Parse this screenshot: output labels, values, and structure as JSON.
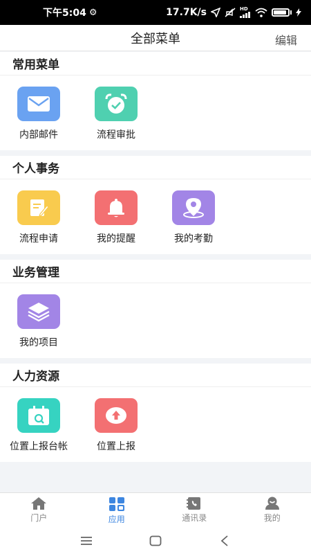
{
  "status_bar": {
    "time": "下午5:04",
    "speed": "17.7K/s",
    "network_badge": "HD"
  },
  "header": {
    "title": "全部菜单",
    "edit_label": "编辑"
  },
  "sections": [
    {
      "title": "常用菜单",
      "items": [
        {
          "label": "内部邮件",
          "icon": "mail-icon",
          "color": "#6aa2f1"
        },
        {
          "label": "流程审批",
          "icon": "alarm-clock-icon",
          "color": "#4fd0b0"
        }
      ]
    },
    {
      "title": "个人事务",
      "items": [
        {
          "label": "流程申请",
          "icon": "edit-note-icon",
          "color": "#f9cb4e"
        },
        {
          "label": "我的提醒",
          "icon": "bell-icon",
          "color": "#f37072"
        },
        {
          "label": "我的考勤",
          "icon": "location-icon",
          "color": "#a285e6"
        }
      ]
    },
    {
      "title": "业务管理",
      "items": [
        {
          "label": "我的项目",
          "icon": "layers-icon",
          "color": "#a285e6"
        }
      ]
    },
    {
      "title": "人力资源",
      "items": [
        {
          "label": "位置上报台帐",
          "icon": "calendar-search-icon",
          "color": "#36d3c1"
        },
        {
          "label": "位置上报",
          "icon": "upload-icon",
          "color": "#f37072"
        }
      ]
    }
  ],
  "bottom_nav": [
    {
      "label": "门户",
      "icon": "home-icon",
      "active": false
    },
    {
      "label": "应用",
      "icon": "apps-grid-icon",
      "active": true
    },
    {
      "label": "通讯录",
      "icon": "contacts-icon",
      "active": false
    },
    {
      "label": "我的",
      "icon": "profile-icon",
      "active": false
    }
  ],
  "colors": {
    "accent": "#3d86e0",
    "inactive": "#888888",
    "page_bg": "#f2f4f7"
  }
}
